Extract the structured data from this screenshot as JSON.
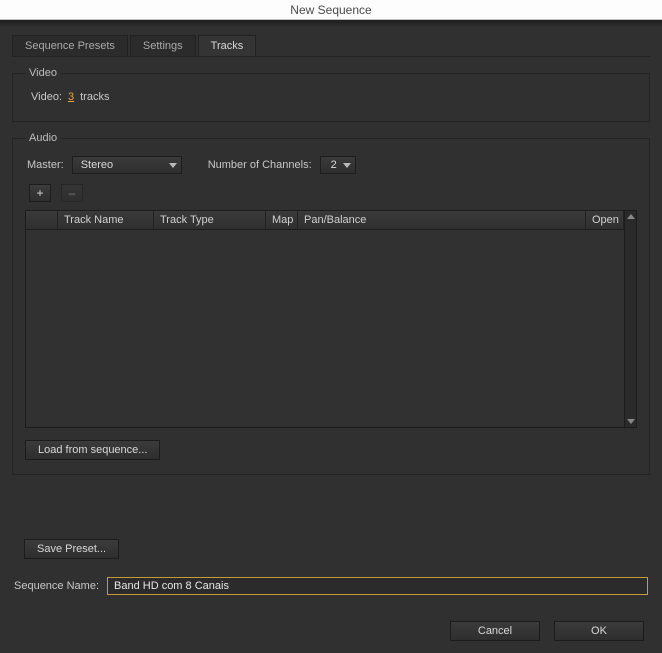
{
  "window": {
    "title": "New Sequence"
  },
  "tabs": [
    {
      "label": "Sequence Presets"
    },
    {
      "label": "Settings"
    },
    {
      "label": "Tracks"
    }
  ],
  "video": {
    "legend": "Video",
    "label": "Video:",
    "count": "3",
    "unit": "tracks"
  },
  "audio": {
    "legend": "Audio",
    "master_label": "Master:",
    "master_value": "Stereo",
    "channels_label": "Number of Channels:",
    "channels_value": "2",
    "add_label": "+",
    "remove_label": "–",
    "columns": {
      "name": "Track Name",
      "type": "Track Type",
      "map": "Map",
      "pan": "Pan/Balance",
      "open": "Open"
    },
    "load_button": "Load from sequence..."
  },
  "save_preset": "Save Preset...",
  "sequence_name": {
    "label": "Sequence Name:",
    "value": "Band HD com 8 Canais"
  },
  "buttons": {
    "cancel": "Cancel",
    "ok": "OK"
  }
}
